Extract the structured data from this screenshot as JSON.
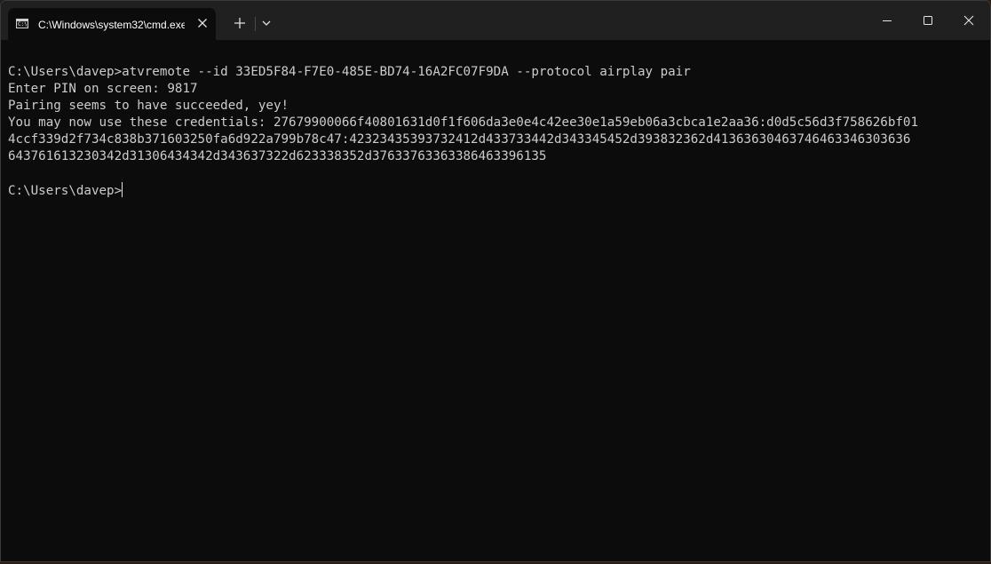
{
  "tab": {
    "title": "C:\\Windows\\system32\\cmd.exe",
    "icon": "cmd-icon",
    "icon_text": "C:\\"
  },
  "titlebar": {
    "new_tab_symbol": "+",
    "close_tab_symbol": "✕"
  },
  "console": {
    "lines": [
      "C:\\Users\\davep>atvremote --id 33ED5F84-F7E0-485E-BD74-16A2FC07F9DA --protocol airplay pair",
      "Enter PIN on screen: 9817",
      "Pairing seems to have succeeded, yey!",
      "You may now use these credentials: 27679900066f40801631d0f1f606da3e0e4c42ee30e1a59eb06a3cbca1e2aa36:d0d5c56d3f758626bf01",
      "4ccf339d2f734c838b371603250fa6d922a799b78c47:42323435393732412d433733442d343345452d393832362d41363630463746463346303636",
      "643761613230342d31306434342d343637322d623338352d37633763363386463396135",
      "",
      "C:\\Users\\davep>"
    ]
  },
  "colors": {
    "console_bg": "#0c0c0c",
    "console_fg": "#cccccc",
    "titlebar_bg": "#202020"
  }
}
